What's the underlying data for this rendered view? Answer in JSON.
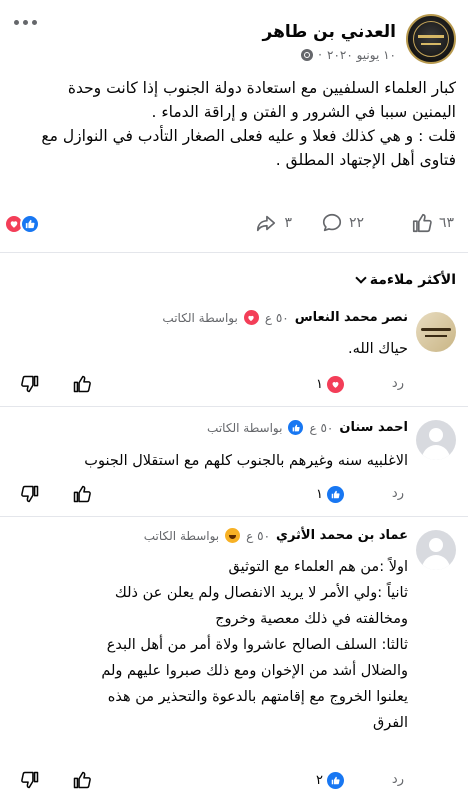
{
  "post": {
    "author": "العدني بن طاهر",
    "date": "١٠ يونيو ٢٠٢٠",
    "text_lines": [
      "كبار العلماء السلفيين مع استعادة دولة الجنوب إذا كانت وحدة",
      "اليمنين سببا في الشرور و الفتن و إراقة الدماء .",
      "قلت : و هي كذلك فعلا و عليه فعلى الصغار التأدب في النوازل مع",
      "فتاوى أهل الإجتهاد المطلق ."
    ],
    "like_count": "٦٣",
    "comment_count": "٢٢",
    "share_count": "٣"
  },
  "sort": {
    "label": "الأكثر ملاءمة"
  },
  "comments": [
    {
      "name": "نصر محمد النعاس",
      "time": "٥٠ ع",
      "by_author": "بواسطة الكاتب",
      "text_lines": [
        "حياك الله."
      ],
      "reply": "رد",
      "reaction_count": "١"
    },
    {
      "name": "احمد سنان",
      "time": "٥٠ ع",
      "by_author": "بواسطة الكاتب",
      "text_lines": [
        "الاغلبيه سنه وغيرهم بالجنوب كلهم مع استقلال الجنوب"
      ],
      "reply": "رد",
      "reaction_count": "١"
    },
    {
      "name": "عماد بن محمد الأثري",
      "time": "٥٠ ع",
      "by_author": "بواسطة الكاتب",
      "text_lines": [
        "اولاً :من هم العلماء مع التوثيق",
        "ثانياً :ولي الأمر لا يريد الانفصال ولم يعلن عن ذلك",
        "ومخالفته في ذلك معصية وخروج",
        "ثالثا: السلف الصالح عاشروا ولاة أمر من أهل البدع",
        "والضلال أشد من الإخوان ومع ذلك صبروا عليهم ولم",
        "يعلنوا الخروج مع إقامتهم بالدعوة والتحذير من هذه",
        "الفرق"
      ],
      "reply": "رد",
      "reaction_count": "٢"
    }
  ],
  "colors": {
    "like_blue": "#1877f2",
    "love_red": "#f33e58",
    "haha_yellow": "#f7b125",
    "meta_gray": "#65676b"
  },
  "icons": [
    "more-icon",
    "globe-icon",
    "like-icon",
    "comment-icon",
    "share-icon",
    "dislike-icon"
  ]
}
